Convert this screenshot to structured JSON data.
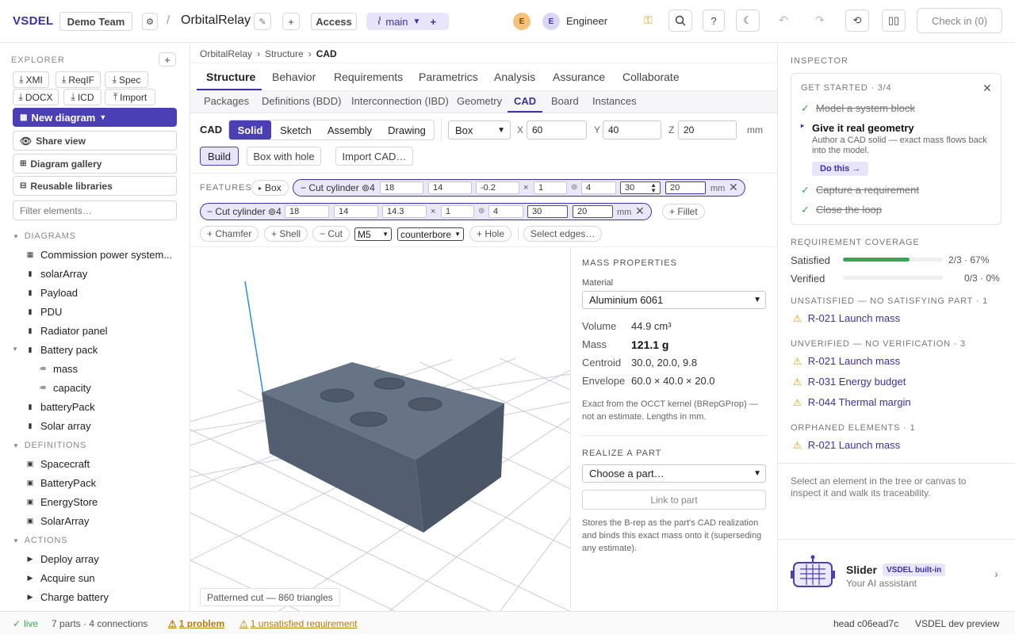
{
  "app": {
    "logo": "VSDEL",
    "team": "Demo Team",
    "project": "OrbitalRelay",
    "access": "Access",
    "branch": "main"
  },
  "header": {
    "avatar1": "E",
    "avatar2": "E",
    "role": "Engineer",
    "check_in": "Check in (0)"
  },
  "explorer": {
    "title": "EXPLORER",
    "buttons": [
      "XMI",
      "ReqIF",
      "Spec",
      "DOCX",
      "ICD",
      "Import"
    ],
    "new_diagram": "New diagram",
    "share_view": "Share view",
    "gallery": "Diagram gallery",
    "libraries": "Reusable libraries",
    "filter_placeholder": "Filter elements…",
    "diagrams_label": "DIAGRAMS",
    "diagrams": [
      "Commission power system...",
      "solarArray",
      "Payload",
      "PDU",
      "Radiator panel",
      "Battery pack",
      "mass",
      "capacity",
      "batteryPack",
      "Solar array"
    ],
    "definitions_label": "DEFINITIONS",
    "definitions": [
      "Spacecraft",
      "BatteryPack",
      "EnergyStore",
      "SolarArray"
    ],
    "actions_label": "ACTIONS",
    "actions": [
      "Deploy array",
      "Acquire sun",
      "Charge battery"
    ]
  },
  "breadcrumb": [
    "OrbitalRelay",
    "Structure",
    "CAD"
  ],
  "tabs": [
    "Structure",
    "Behavior",
    "Requirements",
    "Parametrics",
    "Analysis",
    "Assurance",
    "Collaborate"
  ],
  "subtabs": [
    "Packages",
    "Definitions (BDD)",
    "Interconnection (IBD)",
    "Geometry",
    "CAD",
    "Board",
    "Instances"
  ],
  "cad": {
    "label": "CAD",
    "modes": [
      "Solid",
      "Sketch",
      "Assembly",
      "Drawing"
    ],
    "shape": "Box",
    "x_label": "X",
    "x": "60",
    "y_label": "Y",
    "y": "40",
    "z_label": "Z",
    "z": "20",
    "unit": "mm",
    "build": "Build",
    "box_hole": "Box with hole",
    "import": "Import CAD…",
    "features_label": "FEATURES",
    "box_chip": "Box",
    "feature1": {
      "name": "Cut cylinder ⊚4",
      "v": [
        "18",
        "14",
        "-0.2",
        "1",
        "4",
        "30",
        "20"
      ]
    },
    "feature2": {
      "name": "Cut cylinder ⊚4",
      "v": [
        "18",
        "14",
        "14.3",
        "1",
        "4",
        "30",
        "20"
      ]
    },
    "times": "×",
    "circ": "⊚",
    "mm": "mm",
    "fillet": "+ Fillet",
    "chamfer": "+ Chamfer",
    "shell": "+ Shell",
    "cut": "− Cut",
    "m5": "M5",
    "counterbore": "counterbore",
    "hole": "+ Hole",
    "edges": "Select edges…",
    "viewport_caption": "Patterned cut — 860 triangles"
  },
  "mass": {
    "title": "MASS PROPERTIES",
    "material_label": "Material",
    "material": "Aluminium 6061",
    "volume_k": "Volume",
    "volume": "44.9 cm³",
    "mass_k": "Mass",
    "mass": "121.1 g",
    "centroid_k": "Centroid",
    "centroid": "30.0, 20.0, 9.8",
    "envelope_k": "Envelope",
    "envelope": "60.0 × 40.0 × 20.0",
    "note": "Exact from the OCCT kernel (BRepGProp) — not an estimate. Lengths in mm.",
    "realize_title": "REALIZE A PART",
    "part_select": "Choose a part…",
    "link": "Link to part",
    "realize_note": "Stores the B-rep as the part's CAD realization and binds this exact mass onto it (superseding any estimate)."
  },
  "inspector": {
    "title": "INSPECTOR",
    "get_started": "GET STARTED · 3/4",
    "step1": "Model a system block",
    "step2": "Give it real geometry",
    "step2_desc": "Author a CAD solid — exact mass flows back into the model.",
    "do_this": "Do this →",
    "step3": "Capture a requirement",
    "step4": "Close the loop",
    "coverage_title": "REQUIREMENT COVERAGE",
    "satisfied_k": "Satisfied",
    "satisfied": "2/3 · 67%",
    "satisfied_frac": 0.67,
    "verified_k": "Verified",
    "verified": "0/3 · 0%",
    "verified_frac": 0,
    "unsat_title": "UNSATISFIED — NO SATISFYING PART · 1",
    "unsat": [
      "R-021 Launch mass"
    ],
    "unver_title": "UNVERIFIED — NO VERIFICATION · 3",
    "unver": [
      "R-021 Launch mass",
      "R-031 Energy budget",
      "R-044 Thermal margin"
    ],
    "orphan_title": "ORPHANED ELEMENTS · 1",
    "orphan": [
      "R-021 Launch mass"
    ],
    "hint": "Select an element in the tree or canvas to inspect it and walk its traceability.",
    "slider_name": "Slider",
    "slider_badge": "VSDEL built-in",
    "slider_sub": "Your AI assistant"
  },
  "footer": {
    "live": "live",
    "stats": "7 parts · 4 connections",
    "problem": "1 problem",
    "unsat": "1 unsatisfied requirement",
    "head": "head c06ead7c",
    "preview": "VSDEL dev preview"
  },
  "colors": {
    "accent": "#3b32a8",
    "success": "#3aa655",
    "warn": "#d99a00"
  }
}
